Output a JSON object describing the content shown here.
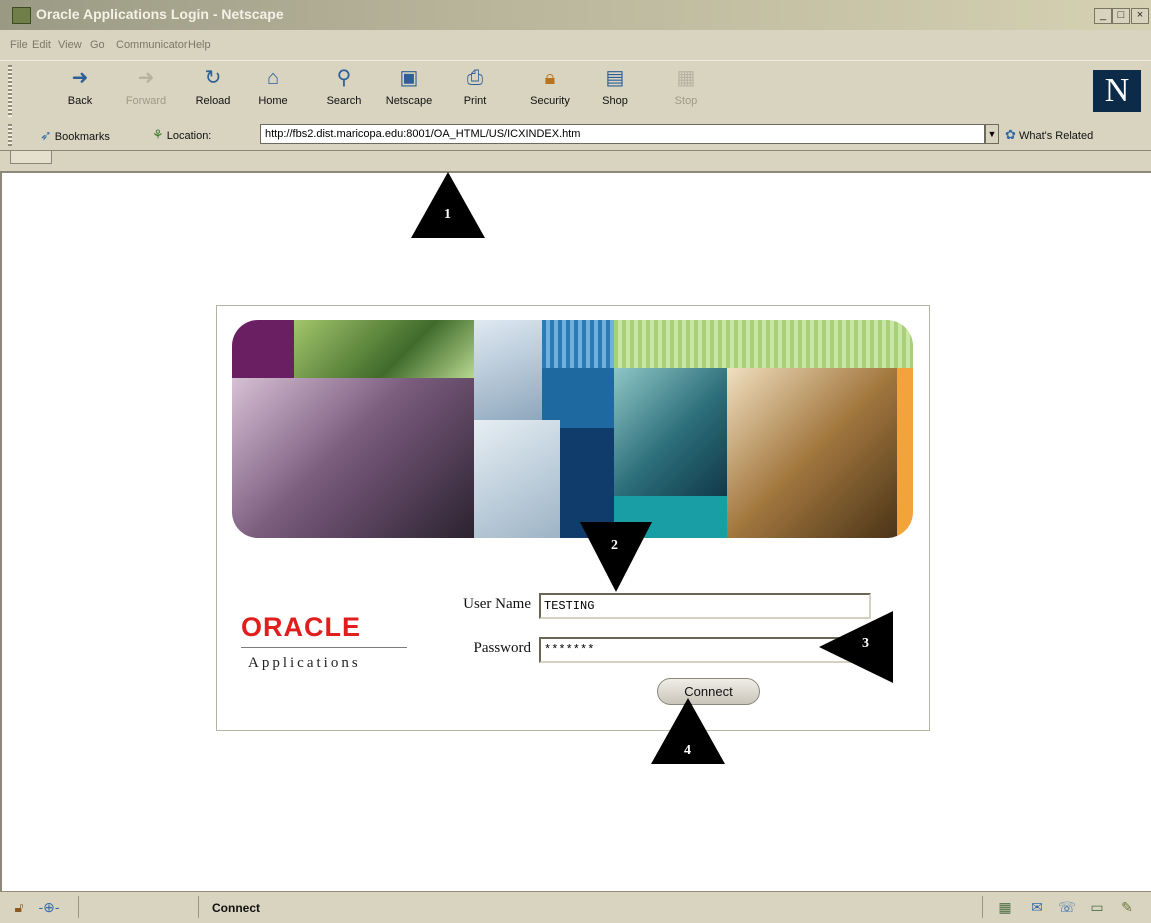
{
  "window": {
    "title": "Oracle Applications Login - Netscape",
    "controls": [
      "_",
      "□",
      "×"
    ]
  },
  "menu": [
    "File",
    "Edit",
    "View",
    "Go",
    "Communicator",
    "Help"
  ],
  "toolbar": [
    {
      "label": "Back",
      "icon": "back-arrow-icon",
      "enabled": true
    },
    {
      "label": "Forward",
      "icon": "forward-arrow-icon",
      "enabled": false
    },
    {
      "label": "Reload",
      "icon": "reload-icon",
      "enabled": true
    },
    {
      "label": "Home",
      "icon": "home-icon",
      "enabled": true
    },
    {
      "label": "Search",
      "icon": "search-icon",
      "enabled": true
    },
    {
      "label": "Netscape",
      "icon": "netscape-icon",
      "enabled": true
    },
    {
      "label": "Print",
      "icon": "print-icon",
      "enabled": true
    },
    {
      "label": "Security",
      "icon": "lock-icon",
      "enabled": true
    },
    {
      "label": "Shop",
      "icon": "shop-icon",
      "enabled": true
    },
    {
      "label": "Stop",
      "icon": "stop-icon",
      "enabled": false
    }
  ],
  "brand_logo": "N",
  "location": {
    "bookmarks_label": "Bookmarks",
    "location_label": "Location:",
    "url": "http://fbs2.dist.maricopa.edu:8001/OA_HTML/US/ICXINDEX.htm",
    "related_label": "What's Related"
  },
  "login": {
    "logo_text": "ORACLE",
    "logo_sub": "Applications",
    "username_label": "User Name",
    "username_value": "TESTING",
    "password_label": "Password",
    "password_value": "*******",
    "connect_label": "Connect"
  },
  "callouts": [
    "1",
    "2",
    "3",
    "4"
  ],
  "status": {
    "text": "Connect"
  },
  "colors": {
    "oracle_red": "#e01e1e",
    "chrome": "#d8d4c0",
    "title_bar": "#b8b49a"
  }
}
